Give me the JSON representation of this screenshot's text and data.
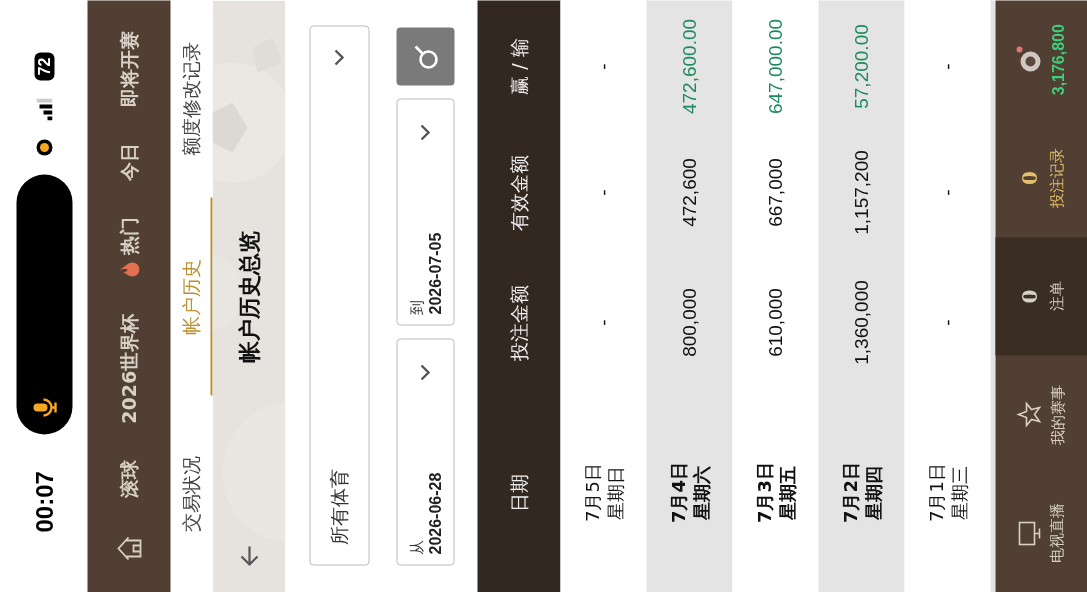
{
  "status_bar": {
    "time": "00:07",
    "battery": "72"
  },
  "nav": {
    "items": [
      {
        "label": "滚球",
        "kind": "plain"
      },
      {
        "label": "2026世界杯",
        "kind": "plain"
      },
      {
        "label": "热门",
        "kind": "hot"
      },
      {
        "label": "今日",
        "kind": "plain"
      },
      {
        "label": "即将开赛",
        "kind": "plain"
      }
    ]
  },
  "subtabs": [
    {
      "label": "交易状况",
      "selected": false
    },
    {
      "label": "帐户历史",
      "selected": true
    },
    {
      "label": "额度修改记录",
      "selected": false
    }
  ],
  "page_title": "帐户历史总览",
  "filters": {
    "sport": "所有体育",
    "from_label": "从",
    "from_date": "2026-06-28",
    "to_label": "到",
    "to_date": "2026-07-05"
  },
  "table": {
    "columns": [
      "日期",
      "投注金额",
      "有效金额",
      "赢 / 输"
    ],
    "rows": [
      {
        "date": "7月5日",
        "weekday": "星期日",
        "bet": "-",
        "valid": "-",
        "win_loss": "-",
        "has_bets": false
      },
      {
        "date": "7月4日",
        "weekday": "星期六",
        "bet": "800,000",
        "valid": "472,600",
        "win_loss": "472,600.00",
        "has_bets": true
      },
      {
        "date": "7月3日",
        "weekday": "星期五",
        "bet": "610,000",
        "valid": "667,000",
        "win_loss": "647,000.00",
        "has_bets": true
      },
      {
        "date": "7月2日",
        "weekday": "星期四",
        "bet": "1,360,000",
        "valid": "1,157,200",
        "win_loss": "57,200.00",
        "has_bets": true
      },
      {
        "date": "7月1日",
        "weekday": "星期三",
        "bet": "-",
        "valid": "-",
        "win_loss": "-",
        "has_bets": false
      }
    ]
  },
  "bottom_bar": {
    "items": [
      {
        "label": "电视直播",
        "kind": "tv",
        "selected": false,
        "highlighted": false
      },
      {
        "label": "我的赛事",
        "kind": "star",
        "selected": false,
        "highlighted": false
      },
      {
        "label": "注单",
        "kind": "count",
        "count": "0",
        "selected": true,
        "highlighted": false
      },
      {
        "label": "投注记录",
        "kind": "count",
        "count": "0",
        "selected": false,
        "highlighted": true
      }
    ],
    "balance": "3,176,800"
  }
}
